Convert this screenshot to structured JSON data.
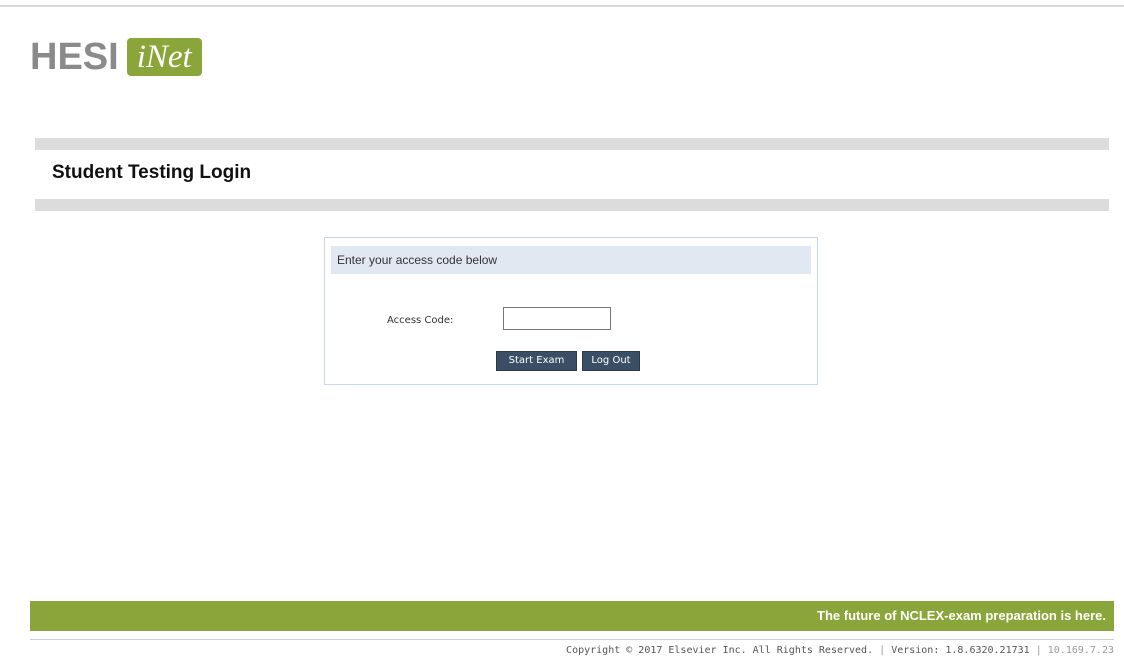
{
  "logo": {
    "brand": "HESI",
    "product": "iNet",
    "colors": {
      "brand_text": "#8a8a8a",
      "accent": "#8aa63a"
    }
  },
  "page": {
    "title": "Student Testing Login"
  },
  "login": {
    "header": "Enter your access code below",
    "access_code_label": "Access Code:",
    "access_code_value": "",
    "start_exam_label": "Start Exam",
    "log_out_label": "Log Out"
  },
  "footer": {
    "tagline": "The future of NCLEX-exam preparation is here.",
    "copyright": "Copyright © 2017 Elsevier Inc. All Rights Reserved.",
    "separator": "|",
    "version": "Version: 1.8.6320.21731",
    "ip": "10.169.7.23"
  },
  "colors": {
    "button_bg": "#3a4f66",
    "header_bg": "#e1e8f2",
    "divider_bar": "#dcdcdc"
  }
}
